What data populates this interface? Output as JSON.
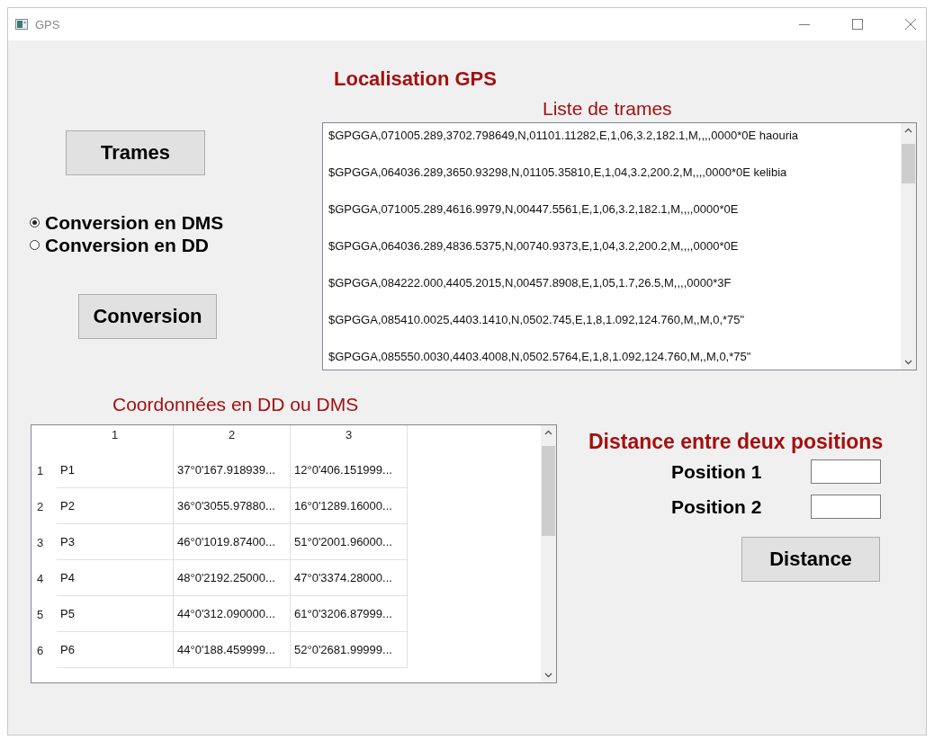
{
  "window": {
    "title": "GPS"
  },
  "heading": "Localisation GPS",
  "trames_button": "Trames",
  "radios": [
    {
      "label": "Conversion en DMS",
      "selected": true
    },
    {
      "label": "Conversion en DD",
      "selected": false
    }
  ],
  "conversion_button": "Conversion",
  "frames": {
    "label": "Liste de trames",
    "items": [
      "$GPGGA,071005.289,3702.798649,N,01101.11282,E,1,06,3.2,182.1,M,,,,0000*0E haouria",
      "$GPGGA,064036.289,3650.93298,N,01105.35810,E,1,04,3.2,200.2,M,,,,0000*0E kelibia",
      "$GPGGA,071005.289,4616.9979,N,00447.5561,E,1,06,3.2,182.1,M,,,,0000*0E",
      "$GPGGA,064036.289,4836.5375,N,00740.9373,E,1,04,3.2,200.2,M,,,,0000*0E",
      "$GPGGA,084222.000,4405.2015,N,00457.8908,E,1,05,1.7,26.5,M,,,,0000*3F",
      "$GPGGA,085410.0025,4403.1410,N,0502.745,E,1,8,1.092,124.760,M,,M,0,*75\"",
      "$GPGGA,085550.0030,4403.4008,N,0502.5764,E,1,8,1.092,124.760,M,,M,0,*75\""
    ]
  },
  "coordinates": {
    "label": "Coordonnées en DD ou DMS",
    "columns": [
      "1",
      "2",
      "3"
    ],
    "rows": [
      {
        "header": "1",
        "cells": [
          "P1",
          "37°0'167.918939...",
          "12°0'406.151999..."
        ]
      },
      {
        "header": "2",
        "cells": [
          "P2",
          "36°0'3055.97880...",
          "16°0'1289.16000..."
        ]
      },
      {
        "header": "3",
        "cells": [
          "P3",
          "46°0'1019.87400...",
          "51°0'2001.96000..."
        ]
      },
      {
        "header": "4",
        "cells": [
          "P4",
          "48°0'2192.25000...",
          "47°0'3374.28000..."
        ]
      },
      {
        "header": "5",
        "cells": [
          "P5",
          "44°0'312.090000...",
          "61°0'3206.87999..."
        ]
      },
      {
        "header": "6",
        "cells": [
          "P6",
          "44°0'188.459999...",
          "52°0'2681.99999..."
        ]
      }
    ]
  },
  "distance": {
    "title": "Distance entre deux positions",
    "fields": [
      {
        "label": "Position 1"
      },
      {
        "label": "Position 2"
      }
    ],
    "button": "Distance"
  }
}
